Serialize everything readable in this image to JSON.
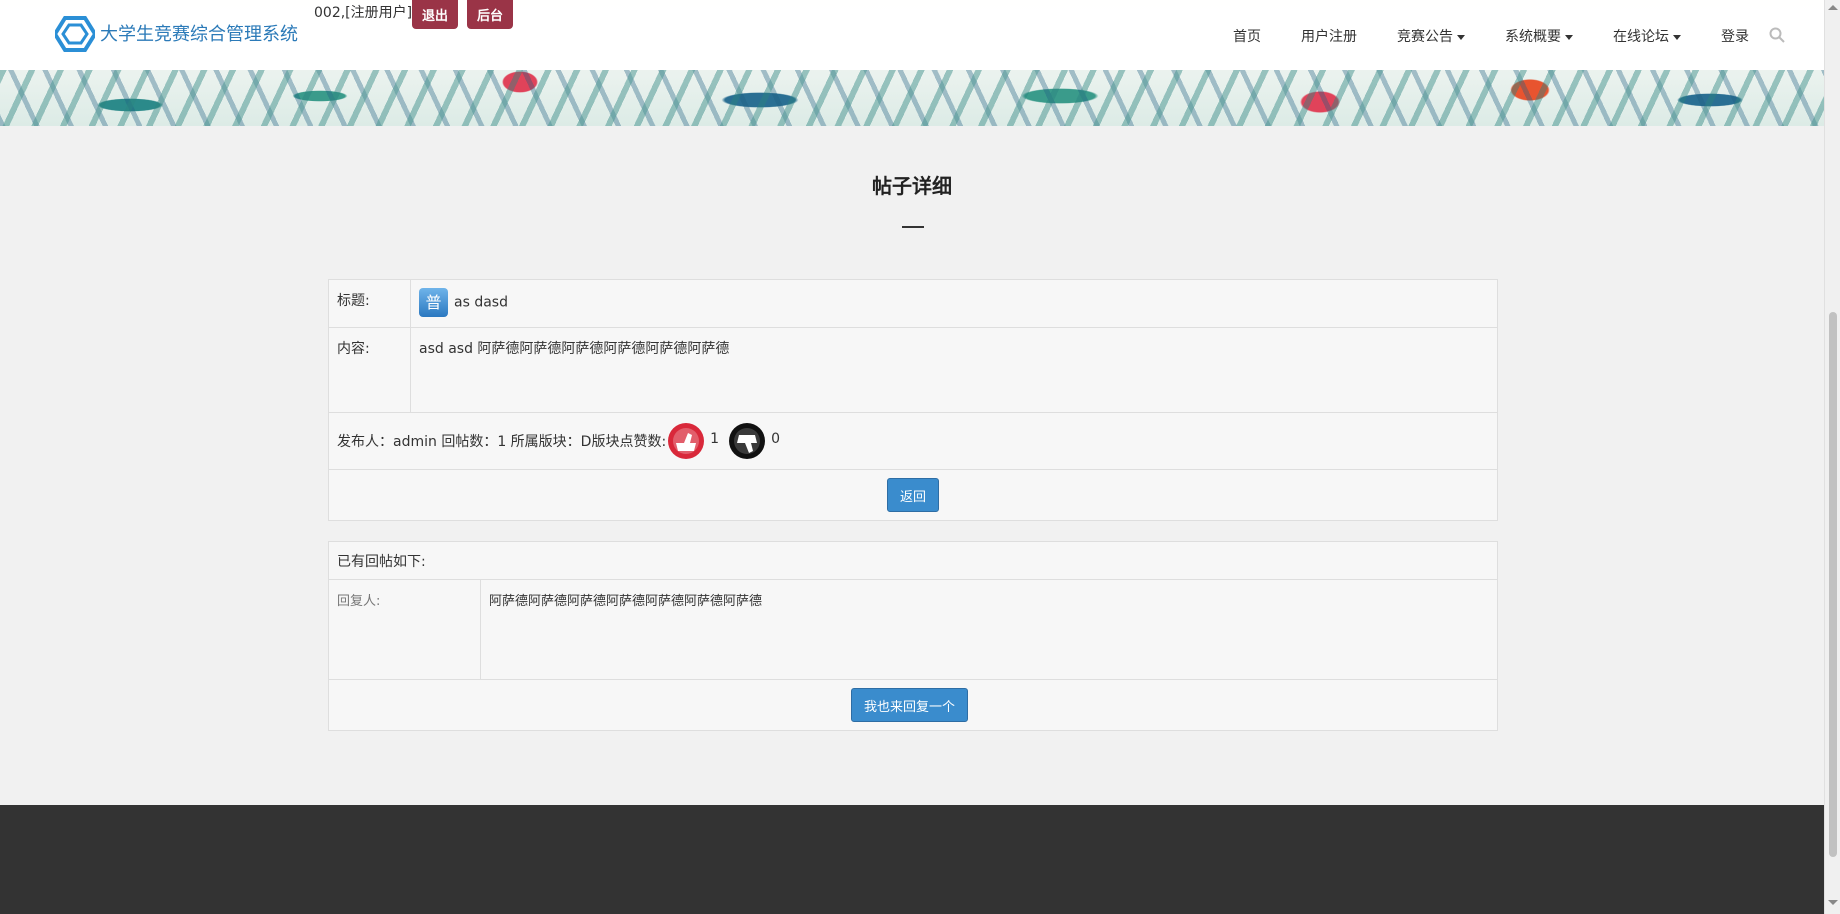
{
  "header": {
    "brand": "大学生竞赛综合管理系统",
    "user_info": "002,[注册用户]",
    "logout_label": "退出",
    "admin_label": "后台",
    "nav": {
      "home": "首页",
      "register": "用户注册",
      "competition": "竞赛公告",
      "overview": "系统概要",
      "forum": "在线论坛",
      "login": "登录"
    }
  },
  "page": {
    "title": "帖子详细"
  },
  "post": {
    "title_label": "标题:",
    "badge": "普",
    "title_value": "as dasd",
    "content_label": "内容:",
    "content_value": "asd asd 阿萨德阿萨德阿萨德阿萨德阿萨德阿萨德",
    "meta_text": "发布人：admin 回帖数：1 所属版块：D版块点赞数:",
    "likes": "1",
    "dislikes": "0",
    "back_label": "返回"
  },
  "replies": {
    "header": "已有回帖如下:",
    "replier_label": "回复人:",
    "reply_content": "阿萨德阿萨德阿萨德阿萨德阿萨德阿萨德阿萨德",
    "reply_button": "我也来回复一个"
  },
  "colors": {
    "brand_blue": "#2b7ab8",
    "dark_red_button": "#9a3447",
    "primary_blue_button": "#3a8ccd",
    "footer": "#333333"
  }
}
